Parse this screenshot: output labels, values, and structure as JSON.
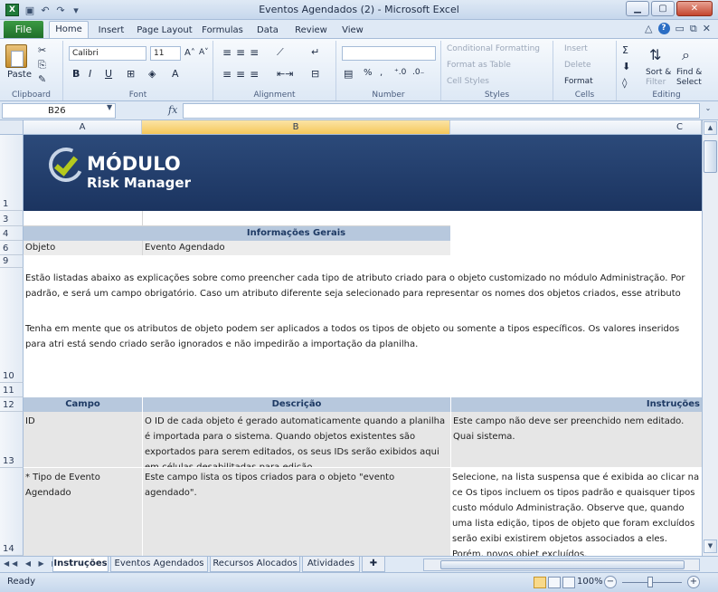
{
  "window": {
    "title": "Eventos Agendados (2)  -  Microsoft Excel",
    "app_icon": "X",
    "minimize": "▁",
    "maximize": "▢",
    "close": "✕"
  },
  "ribbon_tabs": [
    {
      "label": "File"
    },
    {
      "label": "Home"
    },
    {
      "label": "Insert"
    },
    {
      "label": "Page Layout"
    },
    {
      "label": "Formulas"
    },
    {
      "label": "Data"
    },
    {
      "label": "Review"
    },
    {
      "label": "View"
    }
  ],
  "ribbon": {
    "clipboard": {
      "label": "Clipboard",
      "paste": "Paste"
    },
    "font": {
      "label": "Font",
      "name": "Calibri",
      "size": "11",
      "bold": "B",
      "italic": "I",
      "underline": "U"
    },
    "alignment": {
      "label": "Alignment"
    },
    "number": {
      "label": "Number",
      "percent": "%",
      "comma": ","
    },
    "styles": {
      "label": "Styles",
      "conditional": "Conditional Formatting",
      "table": "Format as Table",
      "cell_styles": "Cell Styles"
    },
    "cells": {
      "label": "Cells",
      "insert": "Insert",
      "delete": "Delete",
      "format": "Format"
    },
    "editing": {
      "label": "Editing",
      "sum": "Σ",
      "sort": "Sort &",
      "filter": "Filter",
      "find": "Find &",
      "select": "Select"
    }
  },
  "formula_bar": {
    "name_box": "B26",
    "fx": "fx",
    "value": ""
  },
  "columns": [
    "A",
    "B",
    "C"
  ],
  "rows": [
    "1",
    "3",
    "4",
    "6",
    "9",
    "10",
    "11",
    "12",
    "13",
    "14"
  ],
  "logo": {
    "line1": "MÓDULO",
    "line2": "Risk Manager"
  },
  "sheet": {
    "info_header": "Informações Gerais",
    "objeto_label": "Objeto",
    "objeto_value": "Evento Agendado",
    "intro_p1": "Estão listadas abaixo as explicações sobre como preencher cada tipo de atributo criado para o objeto customizado no módulo Administração. Por padrão, e será um campo obrigatório. Caso um atributo diferente seja selecionado para representar os nomes dos objetos criados, esse atributo será indicado co um campo obrigatório.",
    "intro_p2": "Tenha em mente que os atributos de objeto podem ser aplicados a todos os tipos de objeto ou somente a tipos específicos. Os valores inseridos para atri está sendo criado serão ignorados e não impedirão a importação da planilha.",
    "col_campo": "Campo",
    "col_descricao": "Descrição",
    "col_instrucoes": "Instruções",
    "row13_campo": "ID",
    "row13_desc": "O ID de cada objeto é gerado automaticamente quando a planilha é importada para o sistema. Quando objetos existentes são exportados para serem editados, os seus IDs serão exibidos aqui em células desabilitadas para edição.",
    "row13_instr": "Este campo não deve ser preenchido nem editado. Quai sistema.",
    "row14_campo": "* Tipo de Evento Agendado",
    "row14_desc": "Este campo lista os tipos criados para o objeto \"evento agendado\".",
    "row14_instr": "Selecione, na lista suspensa que é exibida ao clicar na ce Os tipos incluem os tipos padrão e quaisquer tipos custo módulo Administração. Observe que, quando uma lista edição, tipos de objeto que foram excluídos serão exibi existirem objetos associados a eles. Porém, novos objet excluídos."
  },
  "sheet_tabs": [
    {
      "label": "Instruções",
      "active": true
    },
    {
      "label": "Eventos Agendados"
    },
    {
      "label": "Recursos Alocados"
    },
    {
      "label": "Atividades"
    }
  ],
  "status": {
    "ready": "Ready",
    "zoom": "100%",
    "zoom_minus": "−",
    "zoom_plus": "+"
  }
}
